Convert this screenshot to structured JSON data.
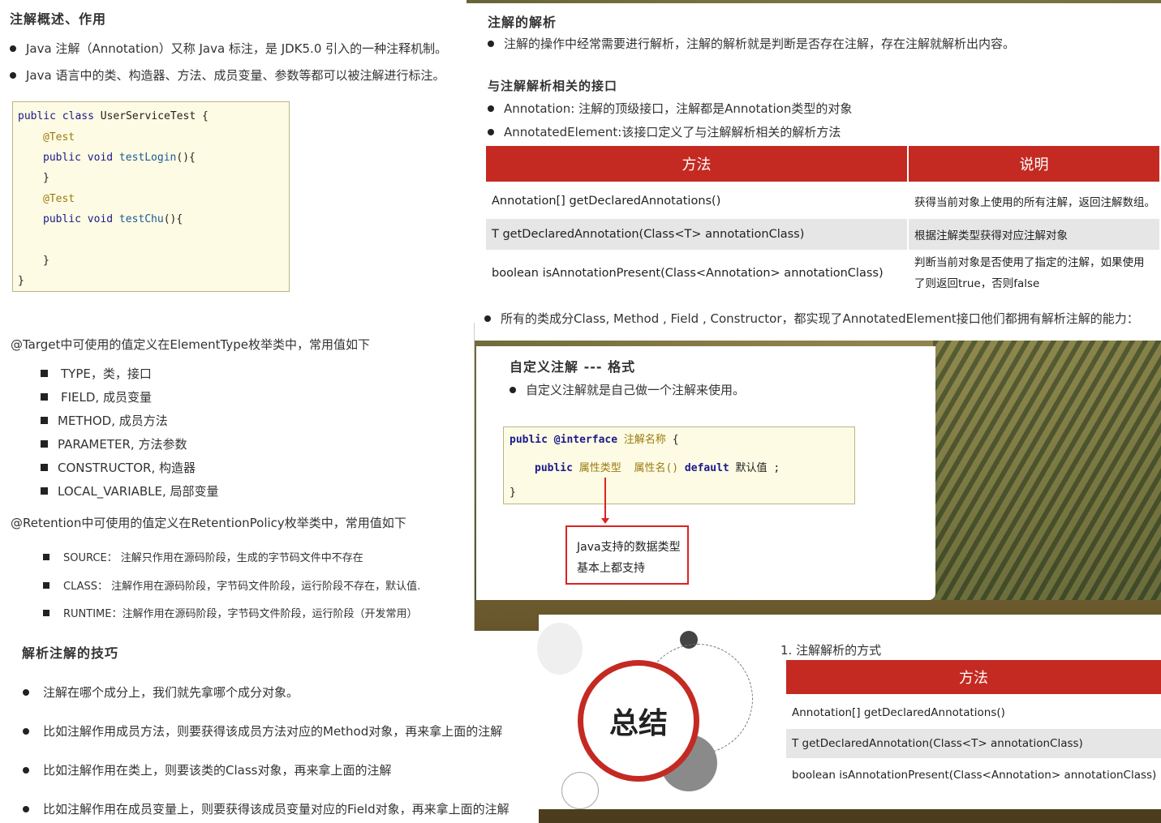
{
  "intro": {
    "title": "注解概述、作用",
    "bullets": [
      "Java 注解（Annotation）又称 Java 标注，是 JDK5.0 引入的一种注释机制。",
      "Java 语言中的类、构造器、方法、成员变量、参数等都可以被注解进行标注。"
    ],
    "code": {
      "l1_kw": "public class",
      "l1_rest": " UserServiceTest {",
      "l2": "@Test",
      "l3_kw": "public void",
      "l3_fn": " testLogin",
      "l3_rest": "(){",
      "l4": "}",
      "l5": "@Test",
      "l6_kw": "public void",
      "l6_fn": " testChu",
      "l6_rest": "(){",
      "l7": "}",
      "l8": "}"
    }
  },
  "parse": {
    "title": "注解的解析",
    "bullet": "注解的操作中经常需要进行解析，注解的解析就是判断是否存在注解，存在注解就解析出内容。",
    "subtitle": "与注解解析相关的接口",
    "interfaces": [
      "Annotation: 注解的顶级接口，注解都是Annotation类型的对象",
      "AnnotatedElement:该接口定义了与注解解析相关的解析方法"
    ],
    "table": {
      "headers": [
        "方法",
        "说明"
      ],
      "rows": [
        [
          "Annotation[]    getDeclaredAnnotations()",
          "获得当前对象上使用的所有注解，返回注解数组。"
        ],
        [
          "T getDeclaredAnnotation(Class<T> annotationClass)",
          "根据注解类型获得对应注解对象"
        ],
        [
          "boolean isAnnotationPresent(Class<Annotation> annotationClass)",
          "判断当前对象是否使用了指定的注解，如果使用了则返回true，否则false"
        ]
      ]
    },
    "footer": "所有的类成分Class, Method , Field , Constructor，都实现了AnnotatedElement接口他们都拥有解析注解的能力："
  },
  "meta": {
    "target_intro": "@Target中可使用的值定义在ElementType枚举类中，常用值如下",
    "target_items": [
      "TYPE，类，接口",
      "FIELD, 成员变量",
      "METHOD, 成员方法",
      "PARAMETER, 方法参数",
      "CONSTRUCTOR, 构造器",
      "LOCAL_VARIABLE, 局部变量"
    ],
    "retention_intro": "@Retention中可使用的值定义在RetentionPolicy枚举类中，常用值如下",
    "retention_items": [
      "SOURCE：  注解只作用在源码阶段，生成的字节码文件中不存在",
      "CLASS：   注解作用在源码阶段，字节码文件阶段，运行阶段不存在，默认值.",
      "RUNTIME：注解作用在源码阶段，字节码文件阶段，运行阶段（开发常用）"
    ]
  },
  "custom": {
    "title": "自定义注解 --- 格式",
    "bullet": "自定义注解就是自己做一个注解来使用。",
    "code": {
      "l1_kw": "public @interface",
      "l1_name": " 注解名称",
      "l1_rest": " {",
      "l2_kw": "public",
      "l2_type": " 属性类型  属性名()",
      "l2_def": " default",
      "l2_val": " 默认值 ;",
      "l3": "}"
    },
    "note_line1": "Java支持的数据类型",
    "note_line2": "基本上都支持"
  },
  "tips": {
    "title": "解析注解的技巧",
    "bullets": [
      "注解在哪个成分上，我们就先拿哪个成分对象。",
      "比如注解作用成员方法，则要获得该成员方法对应的Method对象，再来拿上面的注解",
      "比如注解作用在类上，则要该类的Class对象，再来拿上面的注解",
      "比如注解作用在成员变量上，则要获得该成员变量对应的Field对象，再来拿上面的注解"
    ]
  },
  "summary": {
    "badge": "总结",
    "heading": "1.  注解解析的方式",
    "table_header": "方法",
    "rows": [
      "Annotation[]    getDeclaredAnnotations()",
      "T getDeclaredAnnotation(Class<T> annotationClass)",
      "boolean isAnnotationPresent(Class<Annotation> annotationClass)"
    ]
  },
  "colors": {
    "accent_red": "#c42a22",
    "code_bg": "#fdfbe3"
  }
}
